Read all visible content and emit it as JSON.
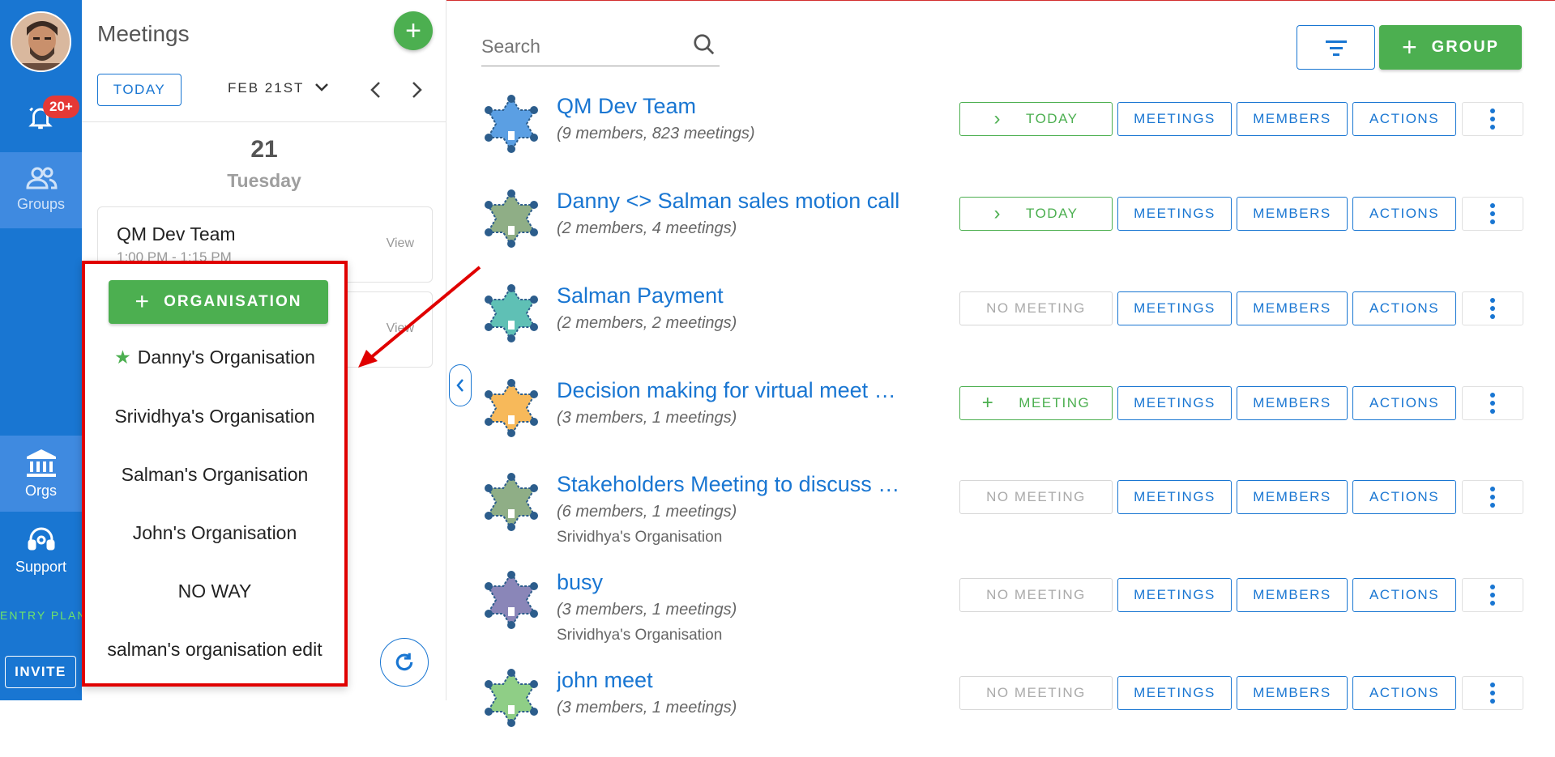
{
  "nav": {
    "notifications_badge": "20+",
    "groups_label": "Groups",
    "orgs_label": "Orgs",
    "support_label": "Support",
    "entry_label": "ENTRY PLAN",
    "invite_label": "INVITE"
  },
  "calendar": {
    "title": "Meetings",
    "add_label": "+",
    "today_label": "TODAY",
    "date_label": "FEB 21ST",
    "prev_label": "‹",
    "next_label": "›",
    "day_number": "21",
    "day_name": "Tuesday",
    "events": [
      {
        "title": "QM Dev Team",
        "time": "1:00 PM - 1:15 PM",
        "view": "View"
      },
      {
        "title": "",
        "time": "",
        "view": "View"
      }
    ]
  },
  "org_popup": {
    "add_label": "ORGANISATION",
    "items": [
      "Danny's Organisation",
      "Srividhya's Organisation",
      "Salman's Organisation",
      "John's Organisation",
      "NO WAY",
      "salman's organisation edit"
    ]
  },
  "main": {
    "search_placeholder": "Search",
    "group_button_label": "GROUP",
    "buttons": {
      "meetings": "MEETINGS",
      "members": "MEMBERS",
      "actions": "ACTIONS"
    },
    "groups": [
      {
        "name": "QM Dev Team",
        "meta": "(9 members, 823 meetings)",
        "org": "",
        "status": "TODAY",
        "status_type": "today",
        "color": "#5b9fe3"
      },
      {
        "name": "Danny <> Salman sales motion call",
        "meta": "(2 members, 4 meetings)",
        "org": "",
        "status": "TODAY",
        "status_type": "today",
        "color": "#8fae86"
      },
      {
        "name": "Salman Payment",
        "meta": "(2 members, 2 meetings)",
        "org": "",
        "status": "NO MEETING",
        "status_type": "none",
        "color": "#5fc0b5"
      },
      {
        "name": "Decision making for virtual meet …",
        "meta": "(3 members, 1 meetings)",
        "org": "",
        "status": "MEETING",
        "status_type": "add",
        "color": "#f7b95a"
      },
      {
        "name": "Stakeholders Meeting to discuss …",
        "meta": "(6 members, 1 meetings)",
        "org": "Srividhya's Organisation",
        "status": "NO MEETING",
        "status_type": "none",
        "color": "#8fae86"
      },
      {
        "name": "busy",
        "meta": "(3 members, 1 meetings)",
        "org": "Srividhya's Organisation",
        "status": "NO MEETING",
        "status_type": "none",
        "color": "#8a86b8"
      },
      {
        "name": "john meet",
        "meta": "(3 members, 1 meetings)",
        "org": "",
        "status": "NO MEETING",
        "status_type": "none",
        "color": "#8fce86"
      }
    ]
  }
}
